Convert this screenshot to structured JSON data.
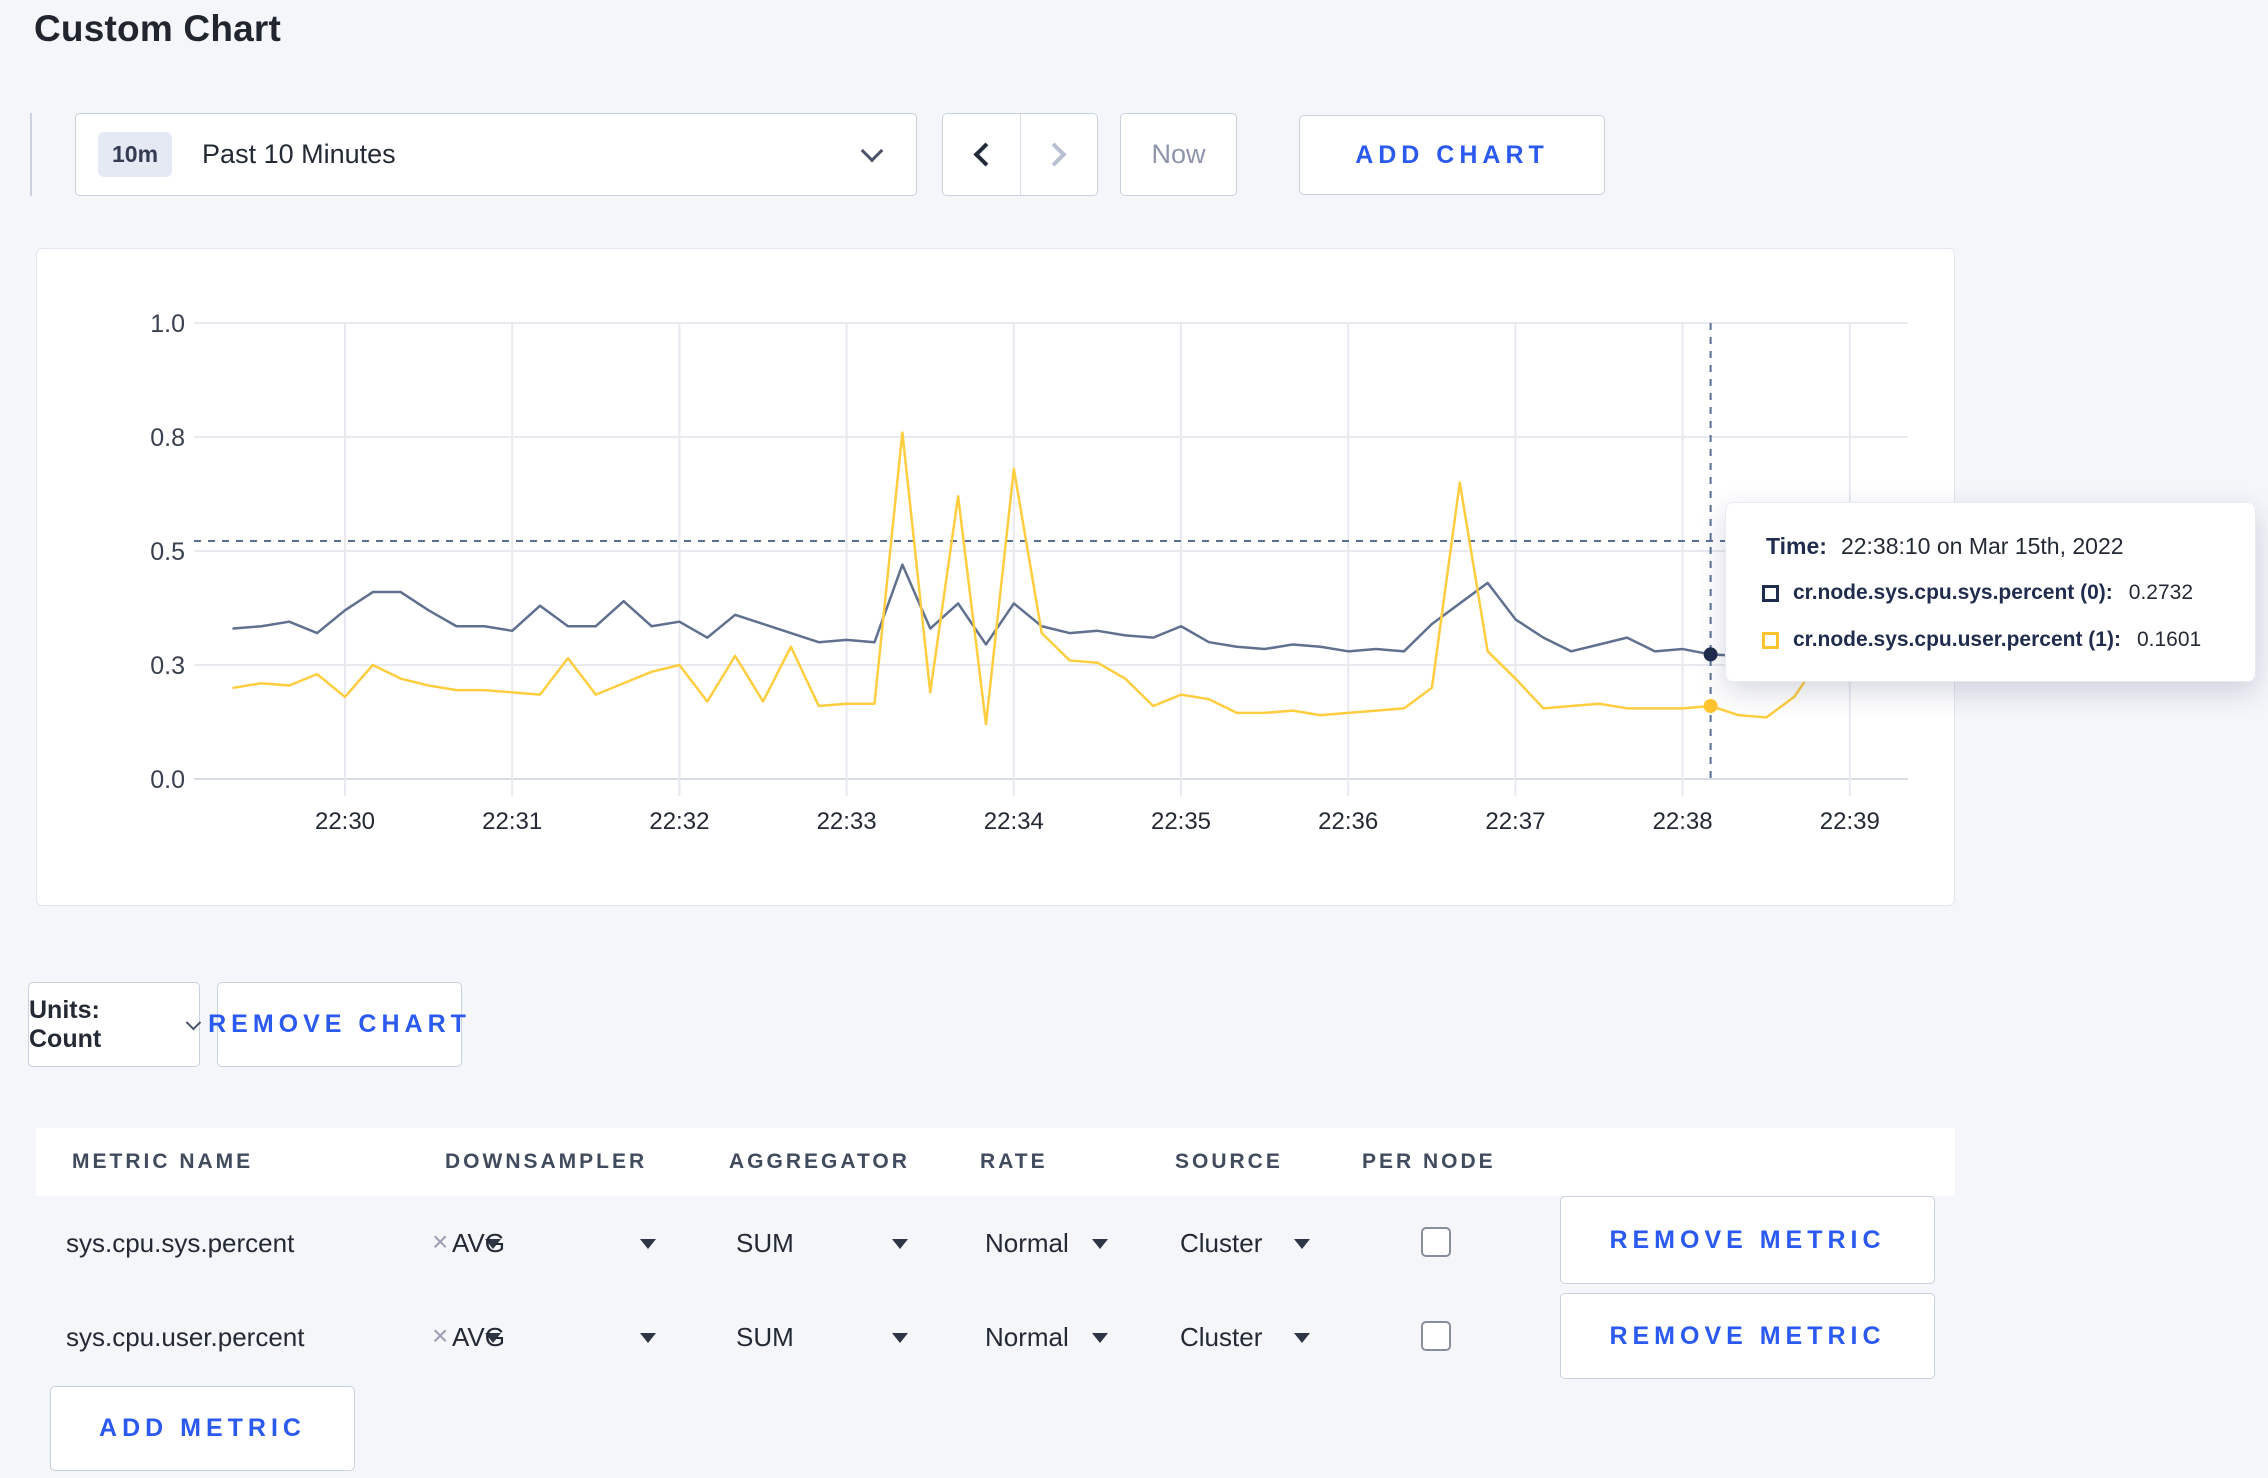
{
  "page": {
    "title": "Custom Chart"
  },
  "toolbar": {
    "time_badge": "10m",
    "time_range_label": "Past 10 Minutes",
    "now_label": "Now",
    "add_chart_label": "ADD CHART"
  },
  "chart_data": {
    "type": "line",
    "title": "",
    "xlabel": "",
    "ylabel": "",
    "ylim": [
      0.0,
      1.0
    ],
    "grid": true,
    "x_ticks": [
      "22:30",
      "22:31",
      "22:32",
      "22:33",
      "22:34",
      "22:35",
      "22:36",
      "22:37",
      "22:38",
      "22:39"
    ],
    "y_tick_labels": [
      "1.0",
      "0.8",
      "0.5",
      "0.3",
      "0.0"
    ],
    "y_tick_values": [
      1.0,
      0.75,
      0.5,
      0.25,
      0.0
    ],
    "start_time": "22:29:20",
    "interval_seconds": 10,
    "series": [
      {
        "name": "cr.node.sys.cpu.sys.percent",
        "node_id": "(0)",
        "color": "#60708f",
        "swatch": "#1f2c4d",
        "values": [
          0.33,
          0.335,
          0.345,
          0.32,
          0.37,
          0.41,
          0.41,
          0.37,
          0.335,
          0.335,
          0.325,
          0.38,
          0.335,
          0.335,
          0.39,
          0.335,
          0.345,
          0.31,
          0.36,
          0.34,
          0.32,
          0.3,
          0.305,
          0.3,
          0.47,
          0.33,
          0.385,
          0.295,
          0.385,
          0.335,
          0.32,
          0.325,
          0.315,
          0.31,
          0.335,
          0.3,
          0.29,
          0.285,
          0.295,
          0.29,
          0.28,
          0.285,
          0.28,
          0.34,
          0.385,
          0.43,
          0.35,
          0.31,
          0.28,
          0.295,
          0.31,
          0.28,
          0.285,
          0.2732,
          0.27,
          0.3,
          0.31,
          0.3,
          0.295,
          0.3,
          0.305
        ]
      },
      {
        "name": "cr.node.sys.cpu.user.percent",
        "node_id": "(1)",
        "color": "#ffcd40",
        "swatch": "#ffc32e",
        "values": [
          0.2,
          0.21,
          0.205,
          0.23,
          0.18,
          0.25,
          0.22,
          0.205,
          0.195,
          0.195,
          0.19,
          0.185,
          0.265,
          0.185,
          0.21,
          0.235,
          0.25,
          0.17,
          0.27,
          0.17,
          0.29,
          0.16,
          0.165,
          0.165,
          0.76,
          0.19,
          0.62,
          0.12,
          0.68,
          0.32,
          0.26,
          0.255,
          0.22,
          0.16,
          0.185,
          0.175,
          0.145,
          0.145,
          0.15,
          0.14,
          0.145,
          0.15,
          0.155,
          0.2,
          0.65,
          0.28,
          0.22,
          0.155,
          0.16,
          0.165,
          0.155,
          0.155,
          0.155,
          0.1601,
          0.14,
          0.135,
          0.18,
          0.27,
          0.22,
          0.24,
          0.28
        ]
      }
    ],
    "crosshair": {
      "index": 53,
      "time": "22:38:10",
      "h_line_value": 0.522
    },
    "legend_position": "tooltip"
  },
  "tooltip": {
    "time_label": "Time:",
    "time_value": "22:38:10 on Mar 15th, 2022",
    "rows": [
      {
        "label": "cr.node.sys.cpu.sys.percent (0):",
        "value": "0.2732"
      },
      {
        "label": "cr.node.sys.cpu.user.percent (1):",
        "value": "0.1601"
      }
    ]
  },
  "chart_controls": {
    "units_label": "Units: Count",
    "remove_chart_label": "REMOVE CHART"
  },
  "metrics_table": {
    "headers": [
      "METRIC NAME",
      "DOWNSAMPLER",
      "AGGREGATOR",
      "RATE",
      "SOURCE",
      "PER NODE"
    ],
    "rows": [
      {
        "metric": "sys.cpu.sys.percent",
        "downsampler": "AVG",
        "aggregator": "SUM",
        "rate": "Normal",
        "source": "Cluster",
        "per_node_checked": false,
        "remove_label": "REMOVE METRIC"
      },
      {
        "metric": "sys.cpu.user.percent",
        "downsampler": "AVG",
        "aggregator": "SUM",
        "rate": "Normal",
        "source": "Cluster",
        "per_node_checked": false,
        "remove_label": "REMOVE METRIC"
      }
    ],
    "add_metric_label": "ADD METRIC"
  },
  "colors": {
    "page_background": "#f4f6fa",
    "accent_blue": "#2b5af0",
    "series_sys": "#60708f",
    "series_user": "#ffcd40",
    "gridline": "#e8eaf0",
    "crosshair": "#5a6f94"
  }
}
